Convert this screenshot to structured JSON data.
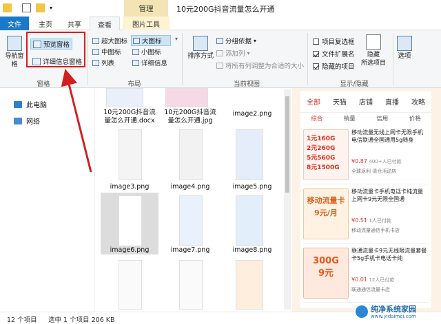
{
  "window": {
    "title": "10元200G抖音流量怎么开通",
    "contextual_tab_title": "管理"
  },
  "tabs": [
    {
      "label": "文件"
    },
    {
      "label": "主页"
    },
    {
      "label": "共享"
    },
    {
      "label": "查看"
    },
    {
      "label": "图片工具"
    }
  ],
  "ribbon": {
    "pane": {
      "navigation_pane": "导航窗格",
      "preview_pane": "预览窗格",
      "details_pane": "详细信息窗格",
      "group_label": "窗格"
    },
    "layout": {
      "items": [
        "超大图标",
        "大图标",
        "中图标",
        "小图标",
        "列表",
        "详细信息"
      ],
      "selected": "大图标",
      "group_label": "布局"
    },
    "current_view": {
      "sort_by": "排序方式",
      "group_by": "分组依据",
      "add_columns": "添加列",
      "fit_columns": "将所有列调整为合适的大小",
      "group_label": "当前视图"
    },
    "show_hide": {
      "item_checkboxes": {
        "label": "项目复选框",
        "checked": false
      },
      "file_extensions": {
        "label": "文件扩展名",
        "checked": true
      },
      "hidden_items": {
        "label": "隐藏的项目",
        "checked": true
      },
      "hide_selected": "隐藏\n所选项目",
      "group_label": "显示/隐藏"
    },
    "options": "选项"
  },
  "nav": {
    "items": [
      {
        "label": "此电脑",
        "icon": "computer-icon"
      },
      {
        "label": "网络",
        "icon": "network-icon"
      }
    ]
  },
  "files": [
    {
      "name": "10元200G抖音流量怎么开通.docx",
      "line1": "10元200G抖音流",
      "line2": "量怎么开通.docx"
    },
    {
      "name": "10元200G抖音流量怎么开通.jpg",
      "line1": "10元200G抖音流",
      "line2": "量怎么开通.jpg"
    },
    {
      "name": "image2.png",
      "line1": "image2.png",
      "line2": ""
    },
    {
      "name": "image3.png",
      "line1": "image3.png",
      "line2": ""
    },
    {
      "name": "image4.png",
      "line1": "image4.png",
      "line2": ""
    },
    {
      "name": "image5.png",
      "line1": "image5.png",
      "line2": ""
    },
    {
      "name": "image6.png",
      "line1": "image6.png",
      "line2": "",
      "selected": true
    },
    {
      "name": "image7.png",
      "line1": "image7.png",
      "line2": ""
    },
    {
      "name": "image8.png",
      "line1": "image8.png",
      "line2": ""
    }
  ],
  "preview": {
    "tabs": [
      "全部",
      "天猫",
      "店铺",
      "直播",
      "攻略"
    ],
    "active_tab": "全部",
    "sort": [
      "综合",
      "销量",
      "信用",
      "价格"
    ],
    "cards": [
      {
        "title": "移动流量无线上网卡无限手机电信联通全国通用5g随身",
        "price": "¥0.87",
        "extra": "400+人已付款",
        "shop": "全球返利 清仓活动店",
        "img_text": "1元160G\n2元260G\n5元560G\n8元1500G",
        "color": "#e34a3c"
      },
      {
        "title": "移动流量卡手机电话卡纯流量上网卡9元无限全国通",
        "price": "¥0.51",
        "extra": "1人已付款",
        "shop": "移动流量通信手机卡店",
        "img_text": "移动流量卡\n9元/月",
        "color": "#f08a2a"
      },
      {
        "title": "联通流量卡9元无线限流量套餐卡5g手机卡电话卡纯",
        "price": "¥0.01",
        "extra": "12人已付款",
        "shop": "联通通信流量卡店",
        "img_text": "300G\n9元",
        "color": "#e9752f"
      }
    ]
  },
  "status": {
    "count": "12 个项目",
    "selection": "选中 1 个项目 206 KB"
  },
  "watermark": {
    "title": "纯净系统家园",
    "url": "www.yidaimei.com"
  },
  "colors": {
    "file_tab": "#1979ca",
    "annotation": "#d21f1f",
    "accent_red": "#e2342a"
  }
}
